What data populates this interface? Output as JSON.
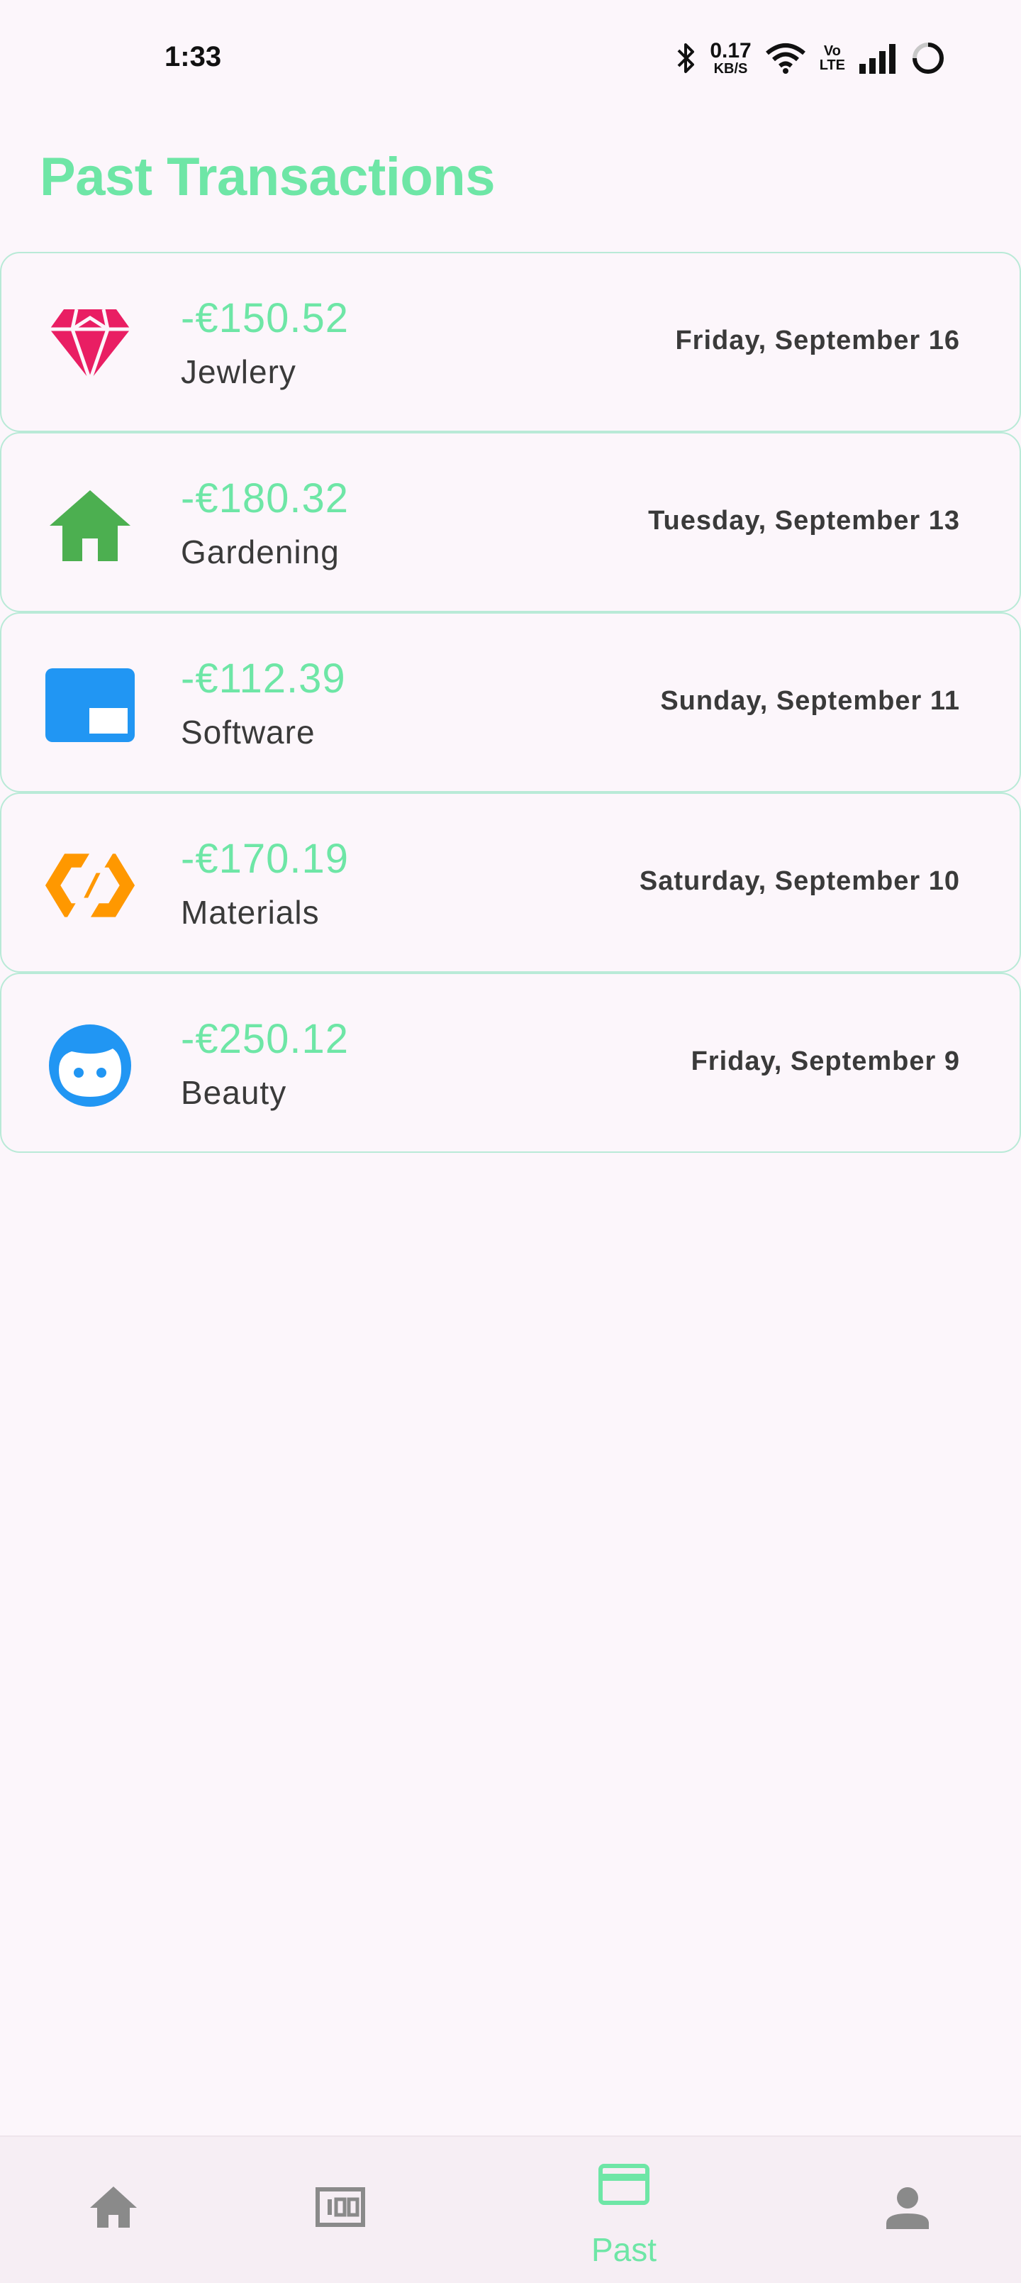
{
  "status_bar": {
    "time": "1:33",
    "net_speed_value": "0.17",
    "net_speed_unit": "KB/S",
    "volte_top": "Vo",
    "volte_bottom": "LTE",
    "icons": [
      "bluetooth-icon",
      "wifi-icon",
      "volte-icon",
      "cell-signal-icon",
      "battery-ring-icon"
    ]
  },
  "page": {
    "title": "Past Transactions"
  },
  "transactions": [
    {
      "amount": "-€150.52",
      "category": "Jewlery",
      "date": "Friday, September 16",
      "icon": "diamond-icon",
      "icon_color": "#e91e63"
    },
    {
      "amount": "-€180.32",
      "category": "Gardening",
      "date": "Tuesday, September 13",
      "icon": "house-icon",
      "icon_color": "#4caf50"
    },
    {
      "amount": "-€112.39",
      "category": "Software",
      "date": "Sunday, September 11",
      "icon": "window-icon",
      "icon_color": "#2196f3"
    },
    {
      "amount": "-€170.19",
      "category": "Materials",
      "date": "Saturday, September 10",
      "icon": "materials-icon",
      "icon_color": "#ff9800"
    },
    {
      "amount": "-€250.12",
      "category": "Beauty",
      "date": "Friday, September 9",
      "icon": "face-icon",
      "icon_color": "#2196f3"
    }
  ],
  "bottom_nav": {
    "items": [
      {
        "icon": "home-icon",
        "label": "",
        "active": false
      },
      {
        "icon": "budget-icon",
        "label": "",
        "active": false
      },
      {
        "icon": "credit-card-icon",
        "label": "Past",
        "active": true
      },
      {
        "icon": "person-icon",
        "label": "",
        "active": false
      }
    ]
  },
  "colors": {
    "accent": "#6ee6a6",
    "background": "#fcf6fb",
    "card_border": "#b9ead7",
    "nav_inactive": "#8a8a8a"
  }
}
